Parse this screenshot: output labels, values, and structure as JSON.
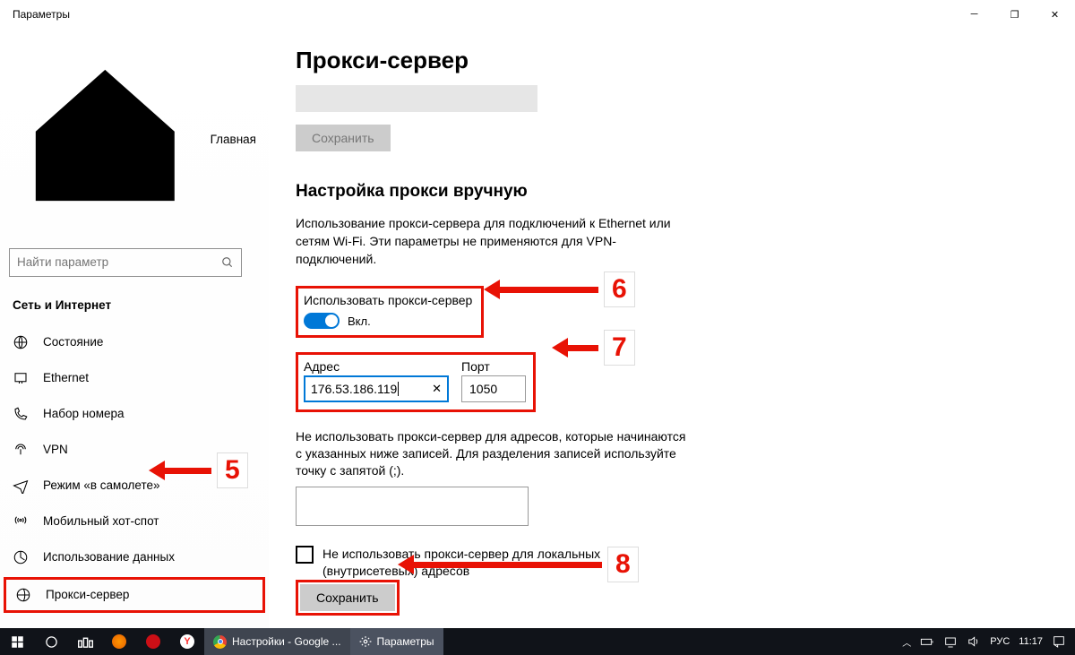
{
  "window": {
    "title": "Параметры"
  },
  "sidebar": {
    "home": "Главная",
    "search_placeholder": "Найти параметр",
    "category": "Сеть и Интернет",
    "items": [
      "Состояние",
      "Ethernet",
      "Набор номера",
      "VPN",
      "Режим «в самолете»",
      "Мобильный хот-спот",
      "Использование данных",
      "Прокси-сервер"
    ]
  },
  "content": {
    "title": "Прокси-сервер",
    "save_top": "Сохранить",
    "manual_heading": "Настройка прокси вручную",
    "manual_desc": "Использование прокси-сервера для подключений к Ethernet или сетям Wi-Fi. Эти параметры не применяются для VPN-подключений.",
    "use_proxy_label": "Использовать прокси-сервер",
    "use_proxy_state": "Вкл.",
    "addr_label": "Адрес",
    "addr_value": "176.53.186.119",
    "port_label": "Порт",
    "port_value": "1050",
    "exclude_desc": "Не использовать прокси-сервер для адресов, которые начинаются с указанных ниже записей. Для разделения записей используйте точку с запятой (;).",
    "local_cb": "Не использовать прокси-сервер для локальных (внутрисетевых) адресов",
    "save_bot": "Сохранить"
  },
  "annotations": {
    "n5": "5",
    "n6": "6",
    "n7": "7",
    "n8": "8"
  },
  "taskbar": {
    "chrome": "Настройки - Google ...",
    "settings": "Параметры",
    "lang": "РУС",
    "time": "11:17"
  }
}
